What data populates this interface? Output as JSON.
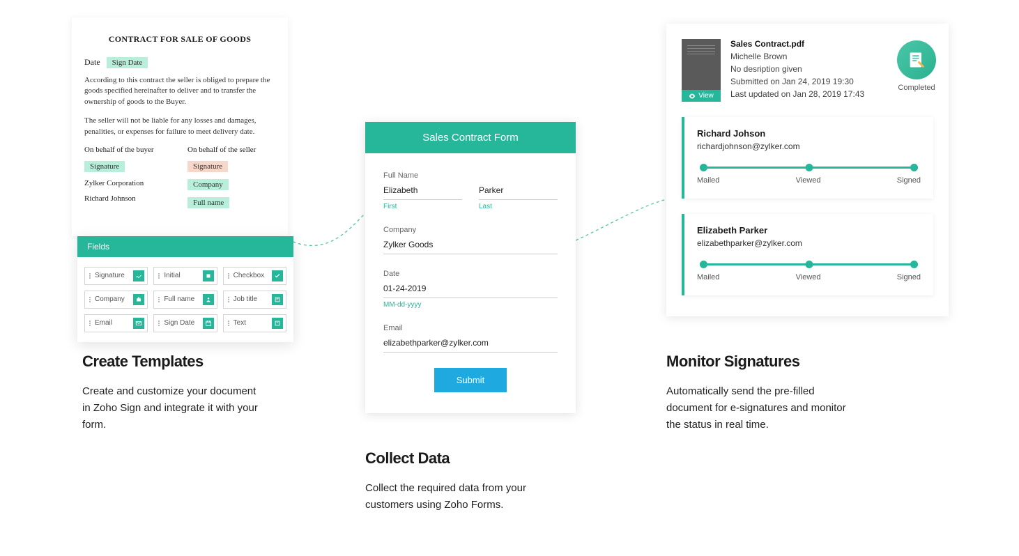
{
  "left": {
    "doc_title": "CONTRACT FOR SALE OF GOODS",
    "date_label": "Date",
    "sign_date_tag": "Sign Date",
    "para1": "According to this contract the seller is obliged to prepare the goods specified hereinafter to deliver and to transfer the ownership of goods to the Buyer.",
    "para2": "The seller will not be liable for any losses and damages, penalities, or expenses for failure to meet delivery date.",
    "buyer_label": "On behalf of the buyer",
    "seller_label": "On behalf of the seller",
    "signature_tag": "Signature",
    "company_tag": "Company",
    "fullname_tag": "Full name",
    "buyer_company": "Zylker Corporation",
    "buyer_name": "Richard Johnson",
    "fields_header": "Fields",
    "fields": [
      "Signature",
      "Initial",
      "Checkbox",
      "Company",
      "Full name",
      "Job title",
      "Email",
      "Sign Date",
      "Text"
    ]
  },
  "mid": {
    "form_title": "Sales Contract Form",
    "fullname_label": "Full Name",
    "first_value": "Elizabeth",
    "last_value": "Parker",
    "first_hint": "First",
    "last_hint": "Last",
    "company_label": "Company",
    "company_value": "Zylker Goods",
    "date_label": "Date",
    "date_value": "01-24-2019",
    "date_hint": "MM-dd-yyyy",
    "email_label": "Email",
    "email_value": "elizabethparker@zylker.com",
    "submit": "Submit"
  },
  "right": {
    "filename": "Sales Contract.pdf",
    "author": "Michelle Brown",
    "desc": "No desription given",
    "submitted": "Submitted on Jan 24, 2019 19:30",
    "updated": "Last updated on Jan 28, 2019 17:43",
    "view": "View",
    "badge": "Completed",
    "signers": [
      {
        "name": "Richard Johson",
        "email": "richardjohnson@zylker.com"
      },
      {
        "name": "Elizabeth Parker",
        "email": "elizabethparker@zylker.com"
      }
    ],
    "step1": "Mailed",
    "step2": "Viewed",
    "step3": "Signed"
  },
  "captions": {
    "c1_h": "Create Templates",
    "c1_p": "Create and customize your document in Zoho Sign and integrate it with your form.",
    "c2_h": "Collect Data",
    "c2_p": "Collect the required data from your customers using Zoho Forms.",
    "c3_h": "Monitor Signatures",
    "c3_p": "Automatically send the pre-filled document for e-signatures and monitor the status in real time."
  }
}
